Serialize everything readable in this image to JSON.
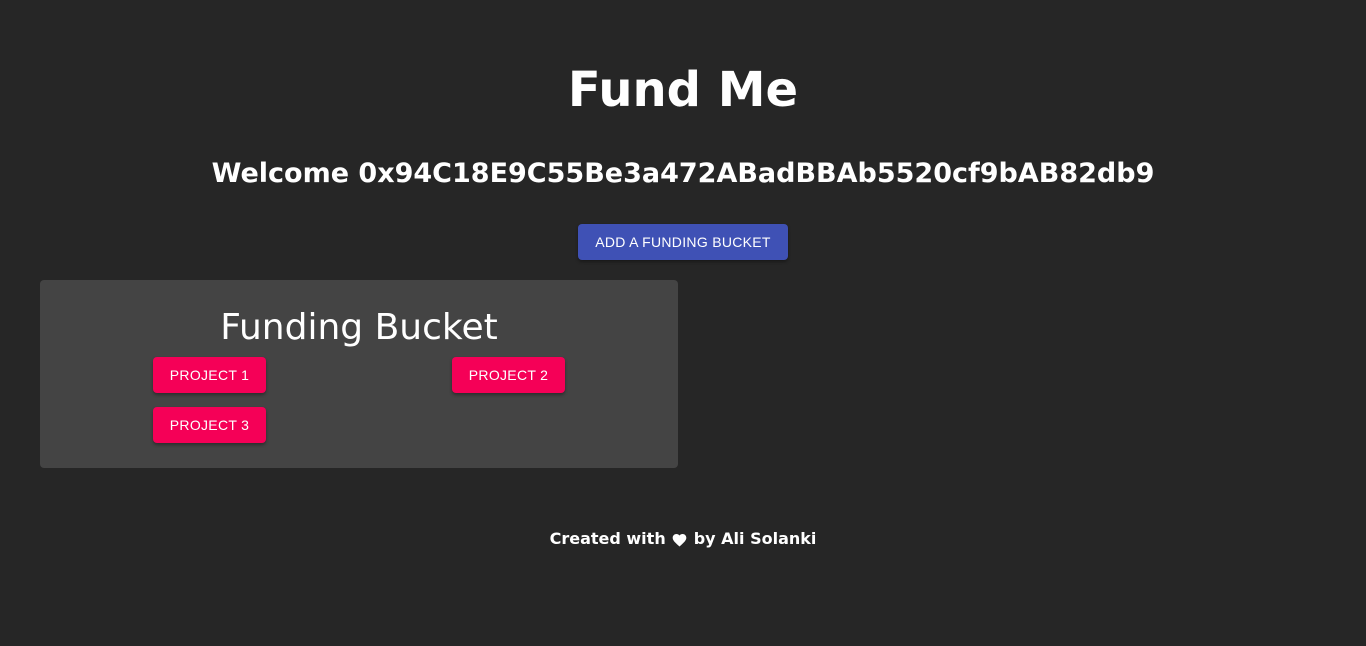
{
  "header": {
    "title": "Fund Me",
    "welcome": "Welcome 0x94C18E9C55Be3a472ABadBBAb5520cf9bAB82db9"
  },
  "actions": {
    "add_bucket_label": "ADD A FUNDING BUCKET"
  },
  "bucket": {
    "title": "Funding Bucket",
    "projects": [
      {
        "label": "PROJECT 1"
      },
      {
        "label": "PROJECT 2"
      },
      {
        "label": "PROJECT 3"
      }
    ]
  },
  "footer": {
    "prefix": "Created with",
    "icon": "heart-icon",
    "suffix": "by Ali Solanki"
  },
  "colors": {
    "background": "#262626",
    "card": "#444444",
    "primary": "#3f51b5",
    "secondary": "#f50057"
  }
}
